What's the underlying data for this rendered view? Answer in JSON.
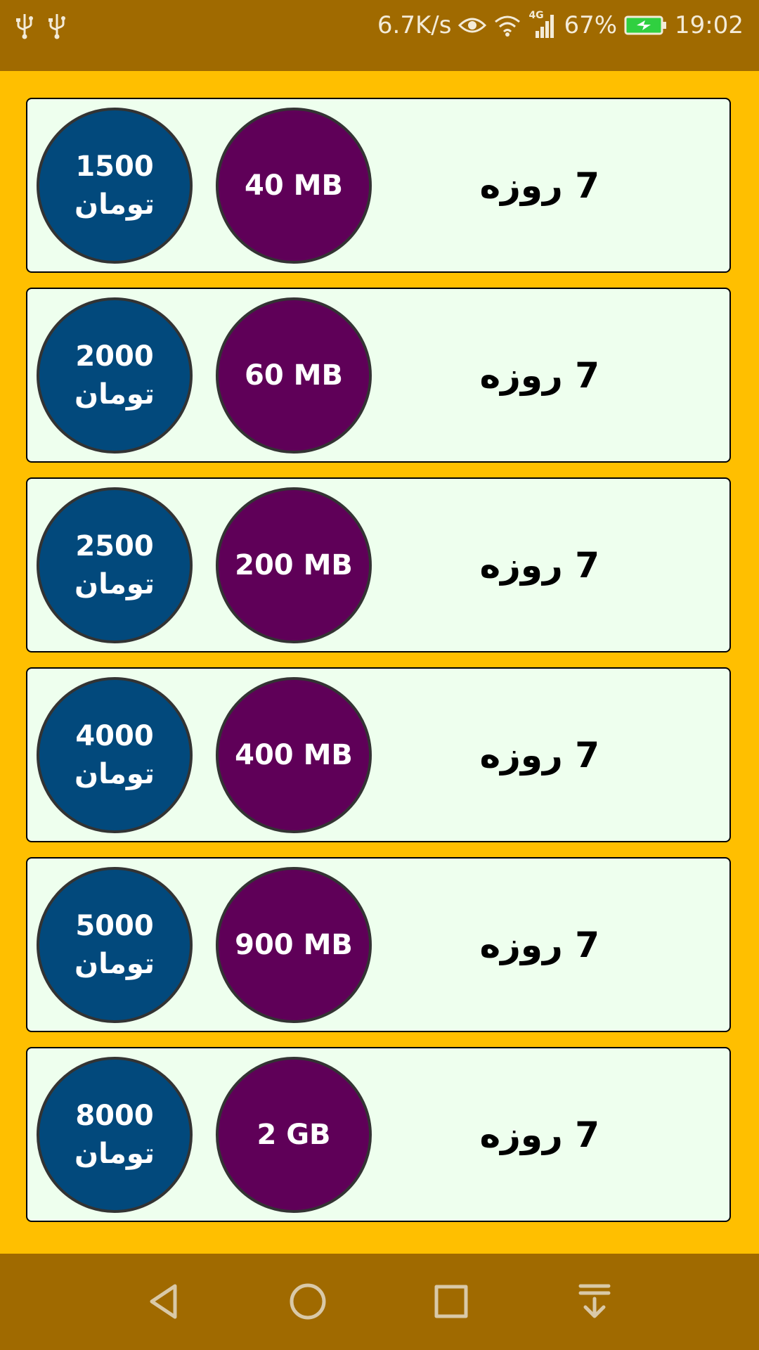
{
  "status_bar": {
    "speed": "6.7K/s",
    "network_label": "4G",
    "battery": "67%",
    "time": "19:02",
    "icons": [
      "usb-icon",
      "usb-icon",
      "eye-icon",
      "wifi-icon",
      "signal-icon",
      "battery-charging-icon"
    ]
  },
  "packages": [
    {
      "price_amount": "1500",
      "price_currency": "تومان",
      "volume": "40 MB",
      "duration": "7 روزه"
    },
    {
      "price_amount": "2000",
      "price_currency": "تومان",
      "volume": "60 MB",
      "duration": "7 روزه"
    },
    {
      "price_amount": "2500",
      "price_currency": "تومان",
      "volume": "200 MB",
      "duration": "7 روزه"
    },
    {
      "price_amount": "4000",
      "price_currency": "تومان",
      "volume": "400 MB",
      "duration": "7 روزه"
    },
    {
      "price_amount": "5000",
      "price_currency": "تومان",
      "volume": "900 MB",
      "duration": "7 روزه"
    },
    {
      "price_amount": "8000",
      "price_currency": "تومان",
      "volume": "2 GB",
      "duration": "7 روزه"
    }
  ],
  "nav_bar": {
    "buttons": [
      "back-icon",
      "home-icon",
      "recents-icon",
      "notification-pulldown-icon"
    ]
  },
  "colors": {
    "status_bar": "#A06A00",
    "background": "#FFBF00",
    "card": "#EEFFEE",
    "price_circle": "#02497C",
    "volume_circle": "#5F0058"
  }
}
